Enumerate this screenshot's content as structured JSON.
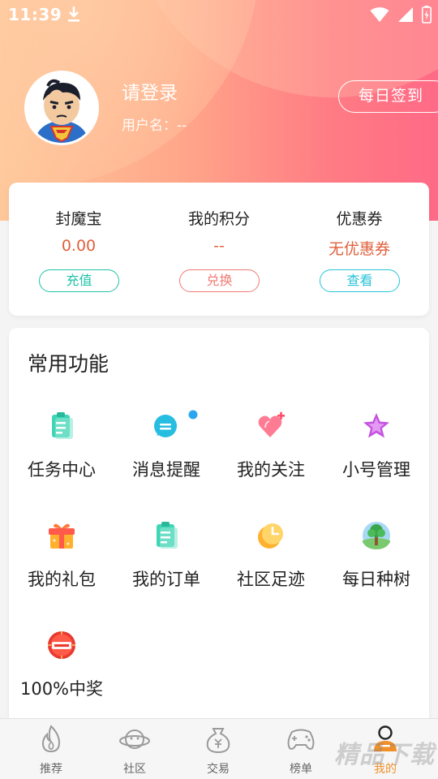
{
  "status_bar": {
    "time": "11:39"
  },
  "profile": {
    "login_title": "请登录",
    "username": "用户名：--",
    "checkin_label": "每日签到"
  },
  "wallet": {
    "items": [
      {
        "label": "封魔宝",
        "value": "0.00",
        "button": "充值",
        "value_color": "#e0603c",
        "button_color": "#1fc2a8"
      },
      {
        "label": "我的积分",
        "value": "--",
        "button": "兑换",
        "value_color": "#e0603c",
        "button_color": "#f07b73"
      },
      {
        "label": "优惠券",
        "value": "无优惠券",
        "button": "查看",
        "value_color": "#e0603c",
        "button_color": "#27c3d9"
      }
    ]
  },
  "functions": {
    "title": "常用功能",
    "items": [
      {
        "label": "任务中心",
        "icon": "clipboard-icon"
      },
      {
        "label": "消息提醒",
        "icon": "chat-bubble-icon"
      },
      {
        "label": "我的关注",
        "icon": "heart-icon"
      },
      {
        "label": "小号管理",
        "icon": "star-icon"
      },
      {
        "label": "我的礼包",
        "icon": "gift-icon"
      },
      {
        "label": "我的订单",
        "icon": "order-clipboard-icon"
      },
      {
        "label": "社区足迹",
        "icon": "clock-icon"
      },
      {
        "label": "每日种树",
        "icon": "tree-icon"
      },
      {
        "label": "100%中奖",
        "icon": "lottery-icon"
      }
    ]
  },
  "tabbar": {
    "items": [
      {
        "label": "推荐",
        "icon": "flame-icon",
        "active": false
      },
      {
        "label": "社区",
        "icon": "planet-icon",
        "active": false
      },
      {
        "label": "交易",
        "icon": "money-bag-icon",
        "active": false
      },
      {
        "label": "榜单",
        "icon": "gamepad-icon",
        "active": false
      },
      {
        "label": "我的",
        "icon": "user-icon",
        "active": true
      }
    ],
    "active_color": "#f0902a"
  },
  "watermark": "精品下载",
  "colors": {
    "accent": "#ff7a85",
    "teal": "#1fc2a8",
    "orange": "#e0603c"
  }
}
